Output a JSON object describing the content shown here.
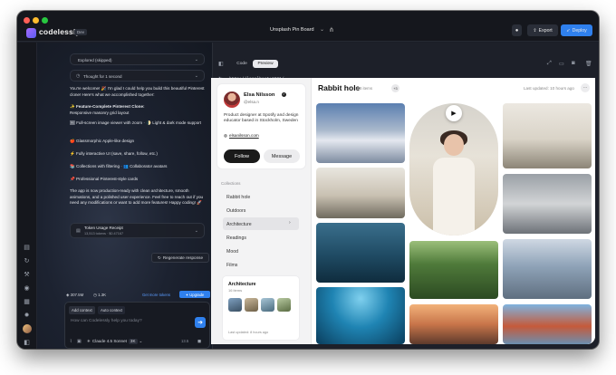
{
  "window": {
    "brand": "codelessly",
    "env_badge": "Dev",
    "project_title": "Unsplash Pin Board",
    "export_label": "Export",
    "deploy_label": "Deploy"
  },
  "chat": {
    "explored_label": "Explored (skipped)",
    "thought_label": "Thought for 1 second",
    "intro": "You're welcome! 🎉 I'm glad I could help you build this beautiful Pinterest clone! Here's what we accomplished together:",
    "feature_heading": "✨ Feature-Complete Pinterest Clone:",
    "layout_line": "Responsive masonry grid layout",
    "features": [
      "🖼 Full-screen image viewer with zoom · 🌓 Light & dark mode support",
      "🍎 Glassmorphic Apple-like design",
      "⚡ Fully interactive UI (save, share, follow, etc.)",
      "📚 Collections with filtering · 👥 Collaborator avatars",
      "📌 Professional Pinterest-style cards"
    ],
    "outro": "The app is now production-ready with clean architecture, smooth animations, and a polished user experience. Feel free to reach out if you need any modifications or want to add more features! Happy coding! 🚀",
    "receipt_title": "Token Usage Receipt",
    "receipt_sub": "13,513 tokens · $0.47167",
    "regenerate_label": "Regenerate response",
    "stat_tokens": "307.5M",
    "stat_other": "1.3K",
    "get_tokens_label": "Get more tokens",
    "upgrade_label": "Upgrade",
    "add_context_label": "Add context",
    "auto_context_label": "Auto context",
    "placeholder": "How can Codelessly help you today?",
    "model_label": "Claude 4.5 Sonnet",
    "model_badge": "3K",
    "token_count": "13.5"
  },
  "preview": {
    "tab_code": "Code",
    "tab_preview": "Preview",
    "url": "http://localhost:3001/"
  },
  "profile": {
    "name": "Elsa Nilsson",
    "handle": "@elsa.n",
    "bio": "Product designer at Spotify and design educator based in Stockholm, Sweden",
    "link": "elsanilsson.com",
    "follow_label": "Follow",
    "message_label": "Message"
  },
  "collections": {
    "header": "Collections",
    "items": [
      "Rabbit hole",
      "Outdoors",
      "Architecture",
      "Readings",
      "Mood",
      "Films"
    ],
    "active_index": 2,
    "card_title": "Architecture",
    "card_sub": "16 items",
    "card_updated": "Last updated: 8 hours ago"
  },
  "board": {
    "title": "Rabbit hole",
    "count": "128 items",
    "collaborators_more": "+3",
    "updated": "Last updated: 10 hours ago",
    "more_icon": "more-horizontal-icon"
  },
  "colors": {
    "accent": "#2f80ed",
    "window_bg": "#1b1e27"
  }
}
